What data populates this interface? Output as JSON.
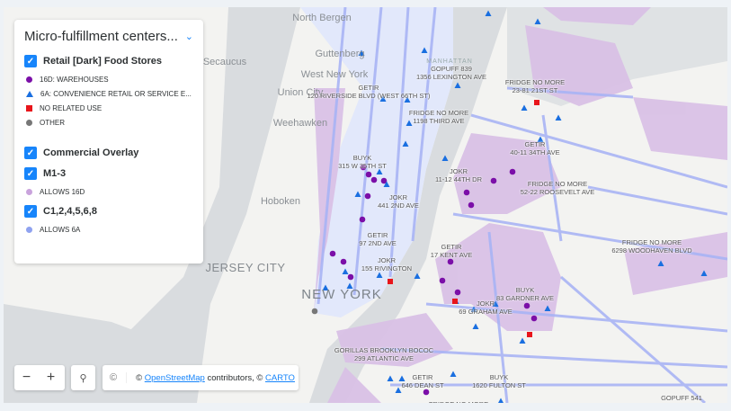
{
  "legend": {
    "title": "Micro-fulfillment centers...",
    "layers": [
      {
        "label": "Retail [Dark] Food Stores",
        "checked": true,
        "items": [
          {
            "label": "16D: WAREHOUSES",
            "shape": "circle",
            "color": "#7b0fa8"
          },
          {
            "label": "6A: CONVENIENCE RETAIL OR SERVICE E...",
            "shape": "triangle",
            "color": "#1a6fe0"
          },
          {
            "label": "NO RELATED USE",
            "shape": "square",
            "color": "#e8151b"
          },
          {
            "label": "OTHER",
            "shape": "circle",
            "color": "#777777"
          }
        ]
      },
      {
        "label": "Commercial Overlay",
        "checked": true,
        "items": []
      },
      {
        "label": "M1-3",
        "checked": true,
        "items": [
          {
            "label": "ALLOWS 16D",
            "shape": "circle",
            "color": "#c9a3dc"
          }
        ]
      },
      {
        "label": "C1,2,4,5,6,8",
        "checked": true,
        "items": [
          {
            "label": "ALLOWS 6A",
            "shape": "circle",
            "color": "#8fa2f0"
          }
        ]
      }
    ]
  },
  "places": [
    "North Bergen",
    "Guttenberg",
    "Secaucus",
    "West New York",
    "Union City",
    "Weehawken",
    "Hoboken",
    "JERSEY CITY",
    "NEW YORK",
    "MANHATTAN"
  ],
  "stores": [
    {
      "name": "GOPUFF 839",
      "addr": "1356 LEXINGTON AVE"
    },
    {
      "name": "GETIR",
      "addr": "120 RIVERSIDE BLVD (WEST 66TH ST)"
    },
    {
      "name": "FRIDGE NO MORE",
      "addr": "23-81 21ST ST"
    },
    {
      "name": "FRIDGE NO MORE",
      "addr": "1198 THIRD AVE"
    },
    {
      "name": "GETIR",
      "addr": "40-11 34TH AVE"
    },
    {
      "name": "BUYK",
      "addr": "315 W 35TH ST"
    },
    {
      "name": "JOKR",
      "addr": "11-12 44TH DR"
    },
    {
      "name": "FRIDGE NO MORE",
      "addr": "52-22 ROOSEVELT AVE"
    },
    {
      "name": "JOKR",
      "addr": "441 2ND AVE"
    },
    {
      "name": "GETIR",
      "addr": "97 2ND AVE"
    },
    {
      "name": "FRIDGE NO MORE",
      "addr": "6298 WOODHAVEN BLVD"
    },
    {
      "name": "GETIR",
      "addr": "17 KENT AVE"
    },
    {
      "name": "JOKR",
      "addr": "155 RIVINGTON"
    },
    {
      "name": "BUYK",
      "addr": "83 GARDNER AVE"
    },
    {
      "name": "JOKR",
      "addr": "69 GRAHAM AVE"
    },
    {
      "name": "GORILLAS BROOKLYN BOCOC",
      "addr": "299 ATLANTIC AVE"
    },
    {
      "name": "GETIR",
      "addr": "646 DEAN ST"
    },
    {
      "name": "BUYK",
      "addr": "1620 FULTON ST"
    },
    {
      "name": "FRIDGE NO MORE",
      "addr": ""
    },
    {
      "name": "GOPUFF 541",
      "addr": ""
    }
  ],
  "controls": {
    "zoom_out": "−",
    "zoom_in": "+",
    "search_icon": "search-icon",
    "info": "©",
    "attr_prefix": "© ",
    "osm": "OpenStreetMap",
    "attr_mid": " contributors, © ",
    "carto": "CARTO"
  }
}
